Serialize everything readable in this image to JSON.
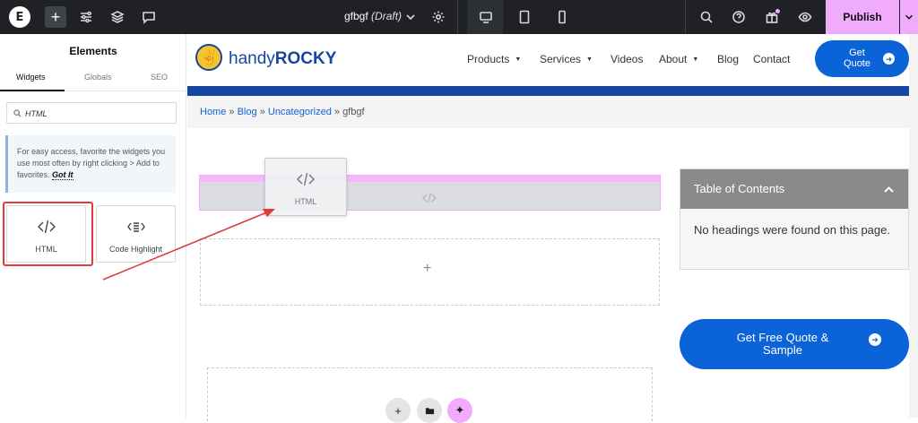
{
  "topbar": {
    "doc_title": "gfbgf",
    "doc_status": "(Draft)",
    "publish_label": "Publish"
  },
  "panel": {
    "title": "Elements",
    "tabs": [
      {
        "label": "Widgets"
      },
      {
        "label": "Globals"
      },
      {
        "label": "SEO"
      }
    ],
    "search_value": "HTML",
    "tip_text": "For easy access, favorite the widgets you use most often by right clicking > Add to favorites.",
    "tip_link": "Got It",
    "widgets": [
      {
        "label": "HTML",
        "icon": "code-icon"
      },
      {
        "label": "Code Highlight",
        "icon": "code-highlight-icon"
      }
    ]
  },
  "site": {
    "brand_light": "handy",
    "brand_bold": "ROCKY",
    "nav": [
      {
        "label": "Products",
        "has_caret": true
      },
      {
        "label": "Services",
        "has_caret": true
      },
      {
        "label": "Videos"
      },
      {
        "label": "About",
        "has_caret": true
      },
      {
        "label": "Blog"
      },
      {
        "label": "Contact"
      }
    ],
    "quote_button": "Get Quote",
    "breadcrumb": {
      "home": "Home",
      "sep": "»",
      "blog": "Blog",
      "category": "Uncategorized",
      "current": "gfbgf"
    },
    "drag_ghost_label": "HTML",
    "empty_section_plus": "+",
    "toc": {
      "title": "Table of Contents",
      "body": "No headings were found on this page."
    },
    "free_quote": "Get Free Quote & Sample"
  },
  "colors": {
    "topbar_bg": "#1f2124",
    "publish_bg": "#f0abfc",
    "brand_blue": "#1746a2",
    "cta_blue": "#0b63d8",
    "highlight_red": "#e23b3b"
  }
}
